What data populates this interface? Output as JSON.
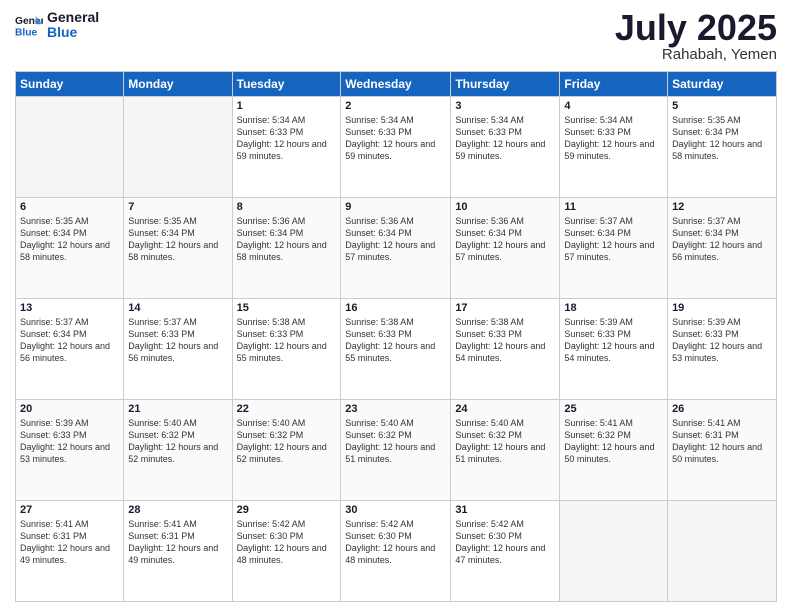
{
  "logo": {
    "line1": "General",
    "line2": "Blue"
  },
  "title": "July 2025",
  "location": "Rahabah, Yemen",
  "weekdays": [
    "Sunday",
    "Monday",
    "Tuesday",
    "Wednesday",
    "Thursday",
    "Friday",
    "Saturday"
  ],
  "weeks": [
    [
      {
        "day": "",
        "info": ""
      },
      {
        "day": "",
        "info": ""
      },
      {
        "day": "1",
        "info": "Sunrise: 5:34 AM\nSunset: 6:33 PM\nDaylight: 12 hours\nand 59 minutes."
      },
      {
        "day": "2",
        "info": "Sunrise: 5:34 AM\nSunset: 6:33 PM\nDaylight: 12 hours\nand 59 minutes."
      },
      {
        "day": "3",
        "info": "Sunrise: 5:34 AM\nSunset: 6:33 PM\nDaylight: 12 hours\nand 59 minutes."
      },
      {
        "day": "4",
        "info": "Sunrise: 5:34 AM\nSunset: 6:33 PM\nDaylight: 12 hours\nand 59 minutes."
      },
      {
        "day": "5",
        "info": "Sunrise: 5:35 AM\nSunset: 6:34 PM\nDaylight: 12 hours\nand 58 minutes."
      }
    ],
    [
      {
        "day": "6",
        "info": "Sunrise: 5:35 AM\nSunset: 6:34 PM\nDaylight: 12 hours\nand 58 minutes."
      },
      {
        "day": "7",
        "info": "Sunrise: 5:35 AM\nSunset: 6:34 PM\nDaylight: 12 hours\nand 58 minutes."
      },
      {
        "day": "8",
        "info": "Sunrise: 5:36 AM\nSunset: 6:34 PM\nDaylight: 12 hours\nand 58 minutes."
      },
      {
        "day": "9",
        "info": "Sunrise: 5:36 AM\nSunset: 6:34 PM\nDaylight: 12 hours\nand 57 minutes."
      },
      {
        "day": "10",
        "info": "Sunrise: 5:36 AM\nSunset: 6:34 PM\nDaylight: 12 hours\nand 57 minutes."
      },
      {
        "day": "11",
        "info": "Sunrise: 5:37 AM\nSunset: 6:34 PM\nDaylight: 12 hours\nand 57 minutes."
      },
      {
        "day": "12",
        "info": "Sunrise: 5:37 AM\nSunset: 6:34 PM\nDaylight: 12 hours\nand 56 minutes."
      }
    ],
    [
      {
        "day": "13",
        "info": "Sunrise: 5:37 AM\nSunset: 6:34 PM\nDaylight: 12 hours\nand 56 minutes."
      },
      {
        "day": "14",
        "info": "Sunrise: 5:37 AM\nSunset: 6:33 PM\nDaylight: 12 hours\nand 56 minutes."
      },
      {
        "day": "15",
        "info": "Sunrise: 5:38 AM\nSunset: 6:33 PM\nDaylight: 12 hours\nand 55 minutes."
      },
      {
        "day": "16",
        "info": "Sunrise: 5:38 AM\nSunset: 6:33 PM\nDaylight: 12 hours\nand 55 minutes."
      },
      {
        "day": "17",
        "info": "Sunrise: 5:38 AM\nSunset: 6:33 PM\nDaylight: 12 hours\nand 54 minutes."
      },
      {
        "day": "18",
        "info": "Sunrise: 5:39 AM\nSunset: 6:33 PM\nDaylight: 12 hours\nand 54 minutes."
      },
      {
        "day": "19",
        "info": "Sunrise: 5:39 AM\nSunset: 6:33 PM\nDaylight: 12 hours\nand 53 minutes."
      }
    ],
    [
      {
        "day": "20",
        "info": "Sunrise: 5:39 AM\nSunset: 6:33 PM\nDaylight: 12 hours\nand 53 minutes."
      },
      {
        "day": "21",
        "info": "Sunrise: 5:40 AM\nSunset: 6:32 PM\nDaylight: 12 hours\nand 52 minutes."
      },
      {
        "day": "22",
        "info": "Sunrise: 5:40 AM\nSunset: 6:32 PM\nDaylight: 12 hours\nand 52 minutes."
      },
      {
        "day": "23",
        "info": "Sunrise: 5:40 AM\nSunset: 6:32 PM\nDaylight: 12 hours\nand 51 minutes."
      },
      {
        "day": "24",
        "info": "Sunrise: 5:40 AM\nSunset: 6:32 PM\nDaylight: 12 hours\nand 51 minutes."
      },
      {
        "day": "25",
        "info": "Sunrise: 5:41 AM\nSunset: 6:32 PM\nDaylight: 12 hours\nand 50 minutes."
      },
      {
        "day": "26",
        "info": "Sunrise: 5:41 AM\nSunset: 6:31 PM\nDaylight: 12 hours\nand 50 minutes."
      }
    ],
    [
      {
        "day": "27",
        "info": "Sunrise: 5:41 AM\nSunset: 6:31 PM\nDaylight: 12 hours\nand 49 minutes."
      },
      {
        "day": "28",
        "info": "Sunrise: 5:41 AM\nSunset: 6:31 PM\nDaylight: 12 hours\nand 49 minutes."
      },
      {
        "day": "29",
        "info": "Sunrise: 5:42 AM\nSunset: 6:30 PM\nDaylight: 12 hours\nand 48 minutes."
      },
      {
        "day": "30",
        "info": "Sunrise: 5:42 AM\nSunset: 6:30 PM\nDaylight: 12 hours\nand 48 minutes."
      },
      {
        "day": "31",
        "info": "Sunrise: 5:42 AM\nSunset: 6:30 PM\nDaylight: 12 hours\nand 47 minutes."
      },
      {
        "day": "",
        "info": ""
      },
      {
        "day": "",
        "info": ""
      }
    ]
  ]
}
